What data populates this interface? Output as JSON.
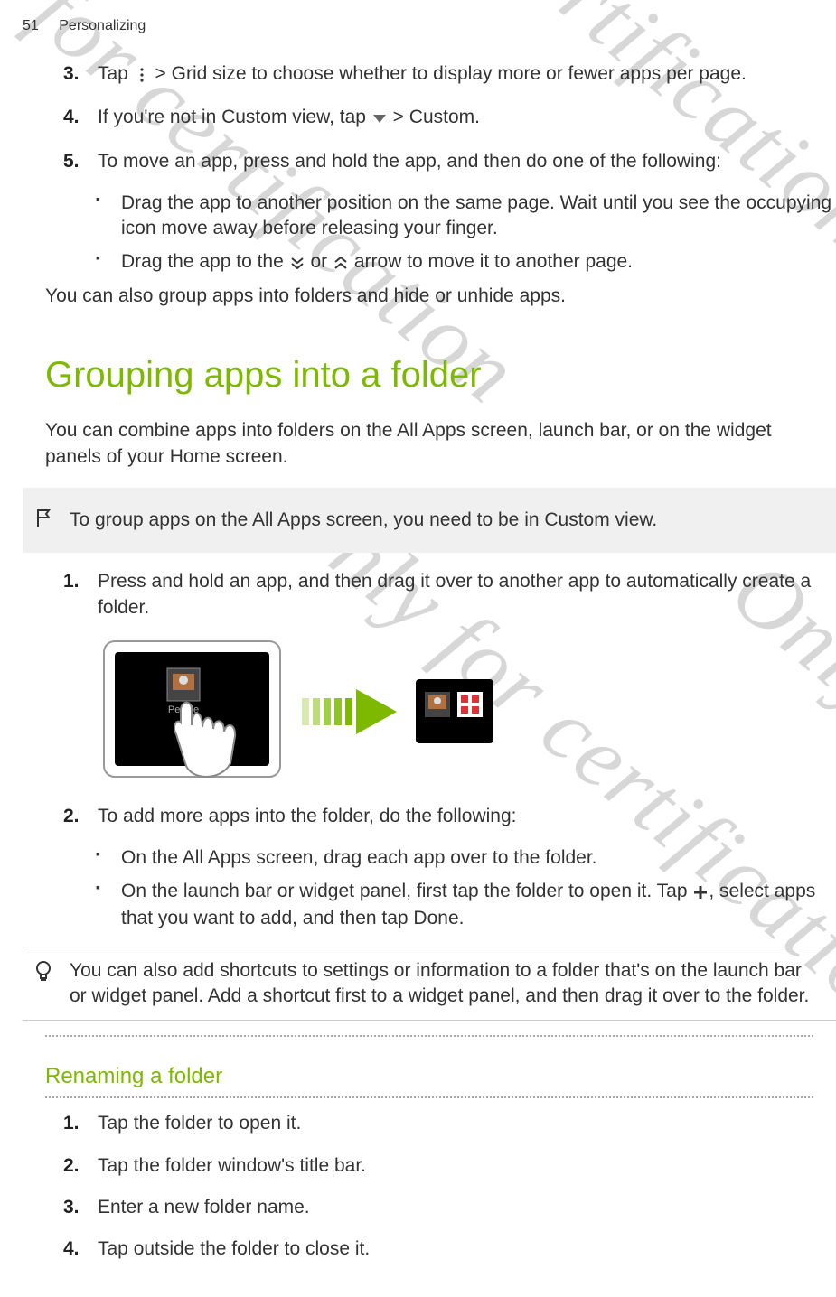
{
  "header": {
    "page": "51",
    "section": "Personalizing"
  },
  "list1": {
    "i3": {
      "num": "3.",
      "pre": "Tap ",
      "link": "Grid size",
      "post": " to choose whether to display more or fewer apps per page."
    },
    "i4": {
      "num": "4.",
      "pre": "If you're not in Custom view, tap ",
      "link": "Custom",
      "post": "."
    },
    "i5": {
      "num": "5.",
      "text": "To move an app, press and hold the app, and then do one of the following:"
    },
    "b1": "Drag the app to another position on the same page. Wait until you see the occupying icon move away before releasing your finger.",
    "b2": {
      "pre": "Drag the app to the ",
      "mid": " or ",
      "post": " arrow to move it to another page."
    }
  },
  "p1": "You can also group apps into folders and hide or unhide apps.",
  "h1": "Grouping apps into a folder",
  "p2": "You can combine apps into folders on the All Apps screen, launch bar, or on the widget panels of your Home screen.",
  "note1": "To group apps on the All Apps screen, you need to be in Custom view.",
  "list2": {
    "i1": {
      "num": "1.",
      "text": "Press and hold an app, and then drag it over to another app to automatically create a folder."
    },
    "i2": {
      "num": "2.",
      "text": "To add more apps into the folder, do the following:"
    },
    "b1": "On the All Apps screen, drag each app over to the folder.",
    "b2": {
      "pre": "On the launch bar or widget panel, first tap the folder to open it. Tap ",
      "mid": ", select apps that you want to add, and then tap ",
      "link": "Done",
      "post": "."
    }
  },
  "tip1": "You can also add shortcuts to settings or information to a folder that's on the launch bar or widget panel. Add a shortcut first to a widget panel, and then drag it over to the folder.",
  "h2": "Renaming a folder",
  "list3": {
    "i1": {
      "num": "1.",
      "text": "Tap the folder to open it."
    },
    "i2": {
      "num": "2.",
      "text": "Tap the folder window's title bar."
    },
    "i3": {
      "num": "3.",
      "text": "Enter a new folder name."
    },
    "i4": {
      "num": "4.",
      "text": "Tap outside the folder to close it."
    }
  },
  "watermark": "Only for certification"
}
